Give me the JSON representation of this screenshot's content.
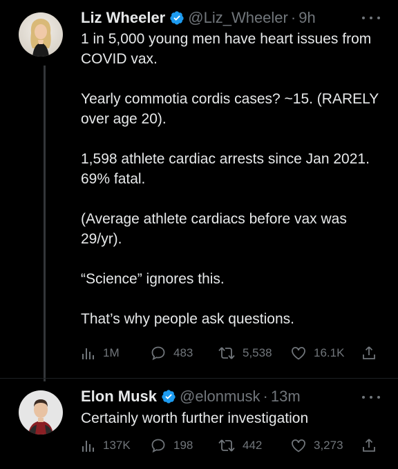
{
  "colors": {
    "background": "#000000",
    "text": "#e7e9ea",
    "secondary": "#71767b",
    "verified": "#1d9bf0"
  },
  "tweets": [
    {
      "author": {
        "name": "Liz Wheeler",
        "handle": "@Liz_Wheeler",
        "time": "9h",
        "verified": true,
        "avatar_icon": "profile-photo"
      },
      "paragraphs": [
        "1 in 5,000 young men have heart issues from COVID vax.",
        "Yearly commotia cordis cases? ~15. (RARELY over age 20).",
        "1,598 athlete cardiac arrests since Jan 2021. 69% fatal.",
        "(Average athlete cardiacs before vax was 29/yr).",
        "“Science” ignores this.",
        "That’s why people ask questions."
      ],
      "stats": {
        "views": "1M",
        "replies": "483",
        "retweets": "5,538",
        "likes": "16.1K"
      }
    },
    {
      "author": {
        "name": "Elon Musk",
        "handle": "@elonmusk",
        "time": "13m",
        "verified": true,
        "avatar_icon": "profile-photo"
      },
      "paragraphs": [
        "Certainly worth further investigation"
      ],
      "stats": {
        "views": "137K",
        "replies": "198",
        "retweets": "442",
        "likes": "3,273"
      }
    }
  ],
  "separator": "·",
  "icons": [
    "views-icon",
    "reply-icon",
    "retweet-icon",
    "like-icon",
    "share-icon",
    "more-icon",
    "verified-icon"
  ]
}
